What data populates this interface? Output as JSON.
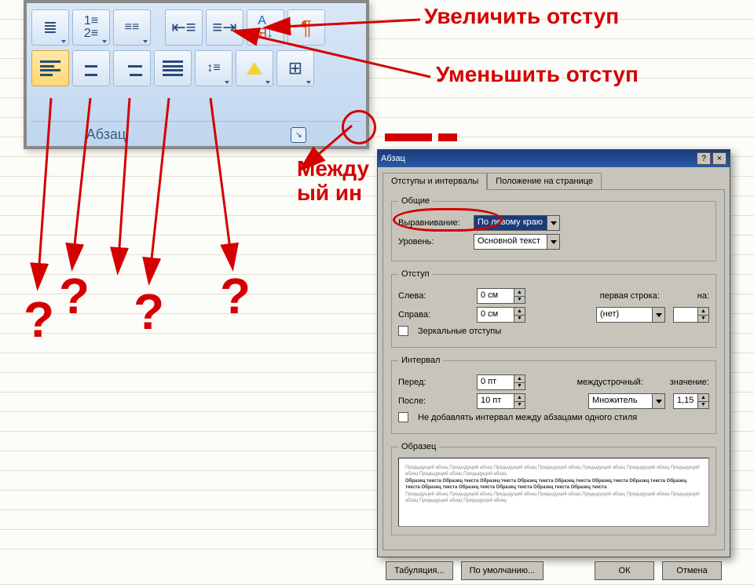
{
  "ribbon": {
    "caption": "Абзац",
    "row1": [
      "bullets",
      "numbering",
      "multilevel",
      "decrease-indent",
      "increase-indent",
      "sort",
      "pilcrow"
    ],
    "row2": [
      "align-left",
      "align-center",
      "align-right",
      "align-justify",
      "line-spacing",
      "shading",
      "borders"
    ]
  },
  "callouts": {
    "increase": "Увеличить отступ",
    "decrease": "Уменьшить отступ",
    "interval_line1": "Между",
    "interval_line2": "ый ин"
  },
  "questions": [
    "?",
    "?",
    "?",
    "?"
  ],
  "dialog": {
    "title": "Абзац",
    "help": "?",
    "close": "×",
    "tabs": {
      "t1": "Отступы и интервалы",
      "t2": "Положение на странице"
    },
    "sec_general": "Общие",
    "alignment_label": "Выравнивание:",
    "alignment_value": "По левому краю",
    "level_label": "Уровень:",
    "level_value": "Основной текст",
    "sec_indent": "Отступ",
    "left_label": "Слева:",
    "left_value": "0 см",
    "right_label": "Справа:",
    "right_value": "0 см",
    "firstline_label": "первая строка:",
    "firstline_value": "(нет)",
    "by_label": "на:",
    "by_value": "",
    "mirror_label": "Зеркальные отступы",
    "sec_spacing": "Интервал",
    "before_label": "Перед:",
    "before_value": "0 пт",
    "after_label": "После:",
    "after_value": "10 пт",
    "linespace_label": "междустрочный:",
    "linespace_value": "Множитель",
    "at_label": "значение:",
    "at_value": "1,15",
    "nospace_label": "Не добавлять интервал между абзацами одного стиля",
    "sec_preview": "Образец",
    "preview_faint": "Предыдущий абзац Предыдущий абзац Предыдущий абзац Предыдущий абзац Предыдущий абзац Предыдущий абзац Предыдущий абзац Предыдущий абзац Предыдущий абзац",
    "preview_bold": "Образец текста Образец текста Образец текста Образец текста Образец текста Образец текста Образец текста Образец текста Образец текста Образец текста Образец текста Образец текста Образец текста",
    "btn_tabs": "Табуляция...",
    "btn_default": "По умолчанию...",
    "btn_ok": "ОК",
    "btn_cancel": "Отмена"
  }
}
